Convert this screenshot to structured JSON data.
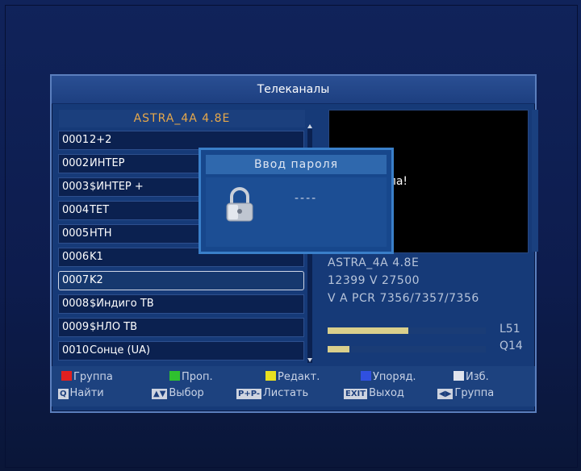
{
  "screen": {
    "title": "Телеканалы",
    "satellite": "ASTRA_4A 4.8E"
  },
  "channels": [
    {
      "num": "0001",
      "name": "2+2"
    },
    {
      "num": "0002",
      "name": "ИНТЕР"
    },
    {
      "num": "0003",
      "name": "$ИНТЕР +"
    },
    {
      "num": "0004",
      "name": "ТЕТ"
    },
    {
      "num": "0005",
      "name": "НТН"
    },
    {
      "num": "0006",
      "name": "K1"
    },
    {
      "num": "0007",
      "name": "K2"
    },
    {
      "num": "0008",
      "name": "$Индиго ТВ"
    },
    {
      "num": "0009",
      "name": "$НЛО ТВ"
    },
    {
      "num": "0010",
      "name": "Сонце (UA)"
    }
  ],
  "selected_channel": "0007",
  "preview": {
    "message": "сигнала!"
  },
  "info": {
    "satellite": "ASTRA_4A 4.8E",
    "transponder": "12399 V 27500",
    "pids": "V A PCR 7356/7357/7356",
    "level_label": "L51",
    "level_value": 51,
    "quality_label": "Q14",
    "quality_value": 14
  },
  "dialog": {
    "title": "Ввод пароля",
    "input_mask": "----",
    "icon": "lock-icon"
  },
  "legend": {
    "row1": [
      {
        "label": "Группа",
        "color": "#e02020"
      },
      {
        "label": "Проп.",
        "color": "#2fc02f"
      },
      {
        "label": "Редакт.",
        "color": "#e8e020"
      },
      {
        "label": "Упоряд.",
        "color": "#3050e0"
      },
      {
        "label": "Изб.",
        "color": "#e0e4ee"
      }
    ],
    "row2": [
      {
        "key": "Q",
        "label": "Найти"
      },
      {
        "key": "▲▼",
        "label": "Выбор"
      },
      {
        "key": "P+P-",
        "label": "Листать"
      },
      {
        "key": "EXIT",
        "label": "Выход"
      },
      {
        "key": "◀▶",
        "label": "Группа"
      }
    ]
  }
}
